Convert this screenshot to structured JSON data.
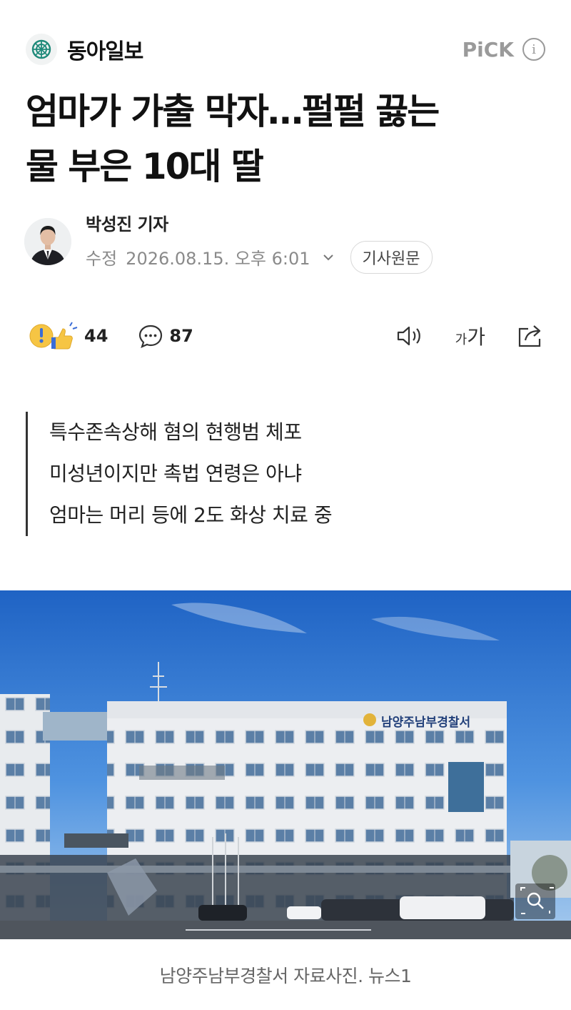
{
  "press": {
    "name": "동아일보",
    "logo_icon": "press-emblem-icon",
    "pick_label": "PiCK",
    "info_icon": "info-icon"
  },
  "headline": {
    "line1": "엄마가 가출 막자…펄펄 끓는",
    "line2": "물 부은 10대 딸"
  },
  "author": {
    "name": "박성진 기자",
    "meta_label": "수정",
    "date": "2026.08.15. 오후 6:01",
    "original_button": "기사원문"
  },
  "reactions": {
    "reaction_count": "44",
    "comment_count": "87"
  },
  "tools": {
    "font_small": "가",
    "font_big": "가"
  },
  "summary": [
    "특수존속상해 혐의 현행범 체포",
    "미성년이지만 촉법 연령은 아냐",
    "엄마는 머리 등에 2도 화상 치료 중"
  ],
  "photo": {
    "sign_text": "남양주남부경찰서"
  },
  "caption": "남양주남부경찰서 자료사진. 뉴스1",
  "colors": {
    "accent_teal": "#1f8a7a",
    "muted": "#9a9a9a"
  }
}
